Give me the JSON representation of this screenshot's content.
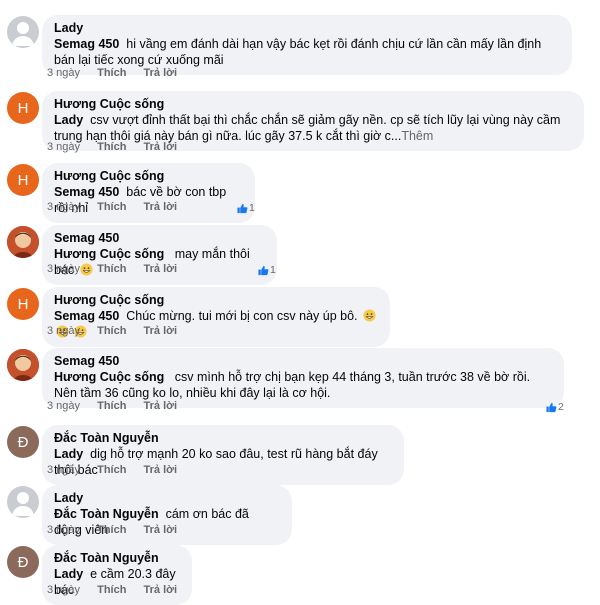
{
  "comments": [
    {
      "author": "Lady",
      "tag": "Semag 450",
      "text": "hi vầng em đánh dài hạn vậy bác kẹt rồi đánh chịu cứ lần cần mấy lần định bán lại tiếc xong cứ xuống mãi",
      "more": "",
      "time": "3 ngày",
      "like": "Thích",
      "reply": "Trả lời",
      "reactions": "",
      "avatar": "gray"
    },
    {
      "author": "Hương Cuộc sống",
      "tag": "Lady",
      "text": "csv vượt đỉnh thất bại thì chắc chắn sẽ giảm gãy nền. cp sẽ tích lũy lại vùng này cầm trung hạn thôi giá này bán gì nữa. lúc gãy 37.5 k cắt thì giờ c...",
      "more": "Thêm",
      "time": "3 ngày",
      "like": "Thích",
      "reply": "Trả lời",
      "reactions": "",
      "avatar": "H"
    },
    {
      "author": "Hương Cuộc sống",
      "tag": "Semag 450",
      "text": "bác về bờ con tbp rồi nhỉ",
      "more": "",
      "time": "3 ngày",
      "like": "Thích",
      "reply": "Trả lời",
      "reactions": "1",
      "avatar": "H"
    },
    {
      "author": "Semag 450",
      "tag": "Hương Cuộc sống",
      "text": "may mắn thôi bác",
      "more": "",
      "time": "3 ngày",
      "like": "Thích",
      "reply": "Trả lời",
      "reactions": "1",
      "avatar": "photo"
    },
    {
      "author": "Hương Cuộc sống",
      "tag": "Semag 450",
      "text": "Chúc mừng. tui mới bị con csv này úp bô.",
      "more": "",
      "time": "3 ngày",
      "like": "Thích",
      "reply": "Trả lời",
      "reactions": "",
      "avatar": "H"
    },
    {
      "author": "Semag 450",
      "tag": "Hương Cuộc sống",
      "text": "csv mình hỗ trợ chị bạn kẹp 44 tháng 3, tuần trước 38 về bờ rồi.  Nên tầm 36 cũng ko lo, nhiều khi đây lại là cơ hội.",
      "more": "",
      "time": "3 ngày",
      "like": "Thích",
      "reply": "Trả lời",
      "reactions": "2",
      "avatar": "photo"
    },
    {
      "author": "Đắc Toàn Nguyễn",
      "tag": "Lady",
      "text": "dig hỗ trợ mạnh 20 ko sao đâu, test rũ hàng bắt đáy thôi bác",
      "more": "",
      "time": "3 ngày",
      "like": "Thích",
      "reply": "Trả lời",
      "reactions": "",
      "avatar": "Đ"
    },
    {
      "author": "Lady",
      "tag": "Đắc Toàn Nguyễn",
      "text": "cám ơn bác đã động viên",
      "more": "",
      "time": "3 ngày",
      "like": "Thích",
      "reply": "Trả lời",
      "reactions": "",
      "avatar": "gray"
    },
    {
      "author": "Đắc Toàn Nguyễn",
      "tag": "Lady",
      "text": "e cầm 20.3 đây bác",
      "more": "",
      "time": "3 ngày",
      "like": "Thích",
      "reply": "Trả lời",
      "reactions": "",
      "avatar": "Đ"
    }
  ],
  "avatar_letters": {
    "h": "H",
    "d": "Đ"
  },
  "colors": {
    "bubble": "#f0f2f5",
    "meta": "#65676b",
    "like_blue": "#1877f2",
    "avatar_h": "#e8661c",
    "avatar_d": "#8b6a5c"
  },
  "icons": {
    "like": "thumbs-up-icon",
    "emoji": "grinning-face-emoji"
  }
}
